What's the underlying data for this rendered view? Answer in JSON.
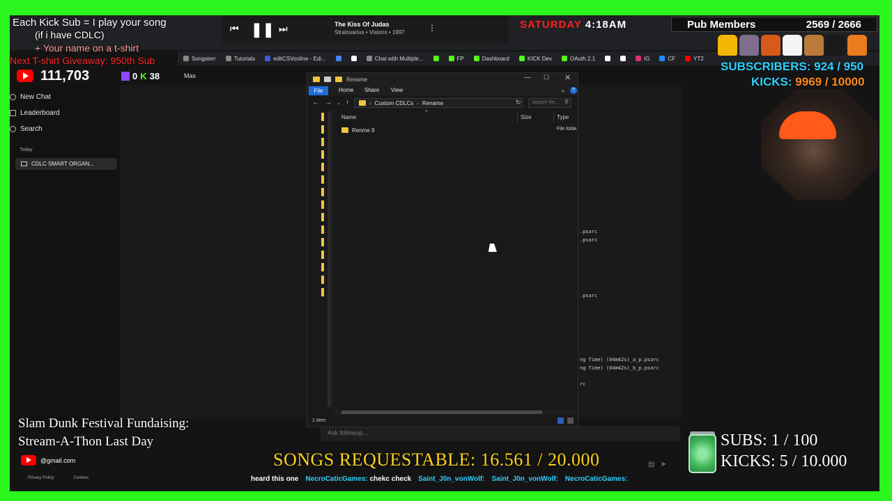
{
  "overlay": {
    "kick_sub_line1": "Each Kick Sub = I play your song",
    "kick_sub_line2": "(if i have CDLC)",
    "kick_sub_line3": "+ Your name on a t-shirt",
    "kick_sub_line4": "Next T-shirt Giveaway: 950th Sub",
    "youtube_count": "111,703",
    "twitch_count": "0",
    "kick_count": "38",
    "max_label": "Max",
    "day": "SATURDAY",
    "time": "4:18AM",
    "pub_members_label": "Pub Members",
    "pub_members_value": "2569 / 2666",
    "subscribers_goal": "SUBSCRIBERS: 924 / 950",
    "kicks_goal_label": "KICKS:",
    "kicks_goal_value": "9969 / 10000",
    "slam_line1": "Slam Dunk Festival Fundaising:",
    "slam_line2": "Stream-A-Thon Last Day",
    "email": "@gmail.com",
    "footer_links": [
      "Privacy Policy",
      "Cookies"
    ],
    "songs_requestable": "SONGS REQUESTABLE: 16.561 / 20.000",
    "subs_count": "SUBS:  1 / 100",
    "kicks_count": "KICKS: 5 / 10.000",
    "ticker": [
      {
        "name": "",
        "text": "heard this one"
      },
      {
        "name": "NecroCaticGames:",
        "text": "chekc check"
      },
      {
        "name": "Saint_J0n_vonWolf:",
        "text": ""
      },
      {
        "name": "Saint_J0n_vonWolf:",
        "text": ""
      },
      {
        "name": "NecroCaticGames:",
        "text": ""
      }
    ]
  },
  "media": {
    "title": "The Kiss Of Judas",
    "artist": "Stratovarius • Visions • 1997"
  },
  "bookmarks": [
    {
      "label": "Songsterr",
      "color": "#888888"
    },
    {
      "label": "Tutorials",
      "color": "#888888"
    },
    {
      "label": "editCSVonline - Edi...",
      "color": "#3b5bdb"
    },
    {
      "label": "",
      "color": "#4285f4"
    },
    {
      "label": "",
      "color": "#ffffff"
    },
    {
      "label": "Chat with Multiple...",
      "color": "#888888"
    },
    {
      "label": "",
      "color": "#53fc18"
    },
    {
      "label": "FP",
      "color": "#53fc18"
    },
    {
      "label": "Dashboard",
      "color": "#53fc18"
    },
    {
      "label": "KICK Dev",
      "color": "#53fc18"
    },
    {
      "label": "OAuth 2.1",
      "color": "#53fc18"
    },
    {
      "label": "",
      "color": "#ffffff"
    },
    {
      "label": "",
      "color": "#ffffff"
    },
    {
      "label": "IG",
      "color": "#e1306c"
    },
    {
      "label": "CF",
      "color": "#1e90ff"
    },
    {
      "label": "YT2",
      "color": "#ff0000"
    }
  ],
  "sidebar": {
    "new_chat": "New Chat",
    "leaderboard": "Leaderboard",
    "search": "Search",
    "today": "Today",
    "history_item": "CDLC SMART ORGAN..."
  },
  "chat": {
    "followup_placeholder": "Ask followup...",
    "lines": [
      ".psarc",
      ".psarc",
      ".psarc",
      "ng Time) (04m42s)_a_p.psarc",
      "ng Time) (04m42s)_b_p.psarc",
      "rc"
    ]
  },
  "explorer": {
    "title": "Rename",
    "ribbon_tabs": [
      "File",
      "Home",
      "Share",
      "View"
    ],
    "breadcrumb": [
      "Custom CDLCs",
      "Rename"
    ],
    "search_placeholder": "Search Re...",
    "columns": [
      "Name",
      "Size",
      "Type"
    ],
    "rows": [
      {
        "name": "Renme 9",
        "size": "",
        "type": "File folde"
      }
    ],
    "status": "1 item"
  }
}
